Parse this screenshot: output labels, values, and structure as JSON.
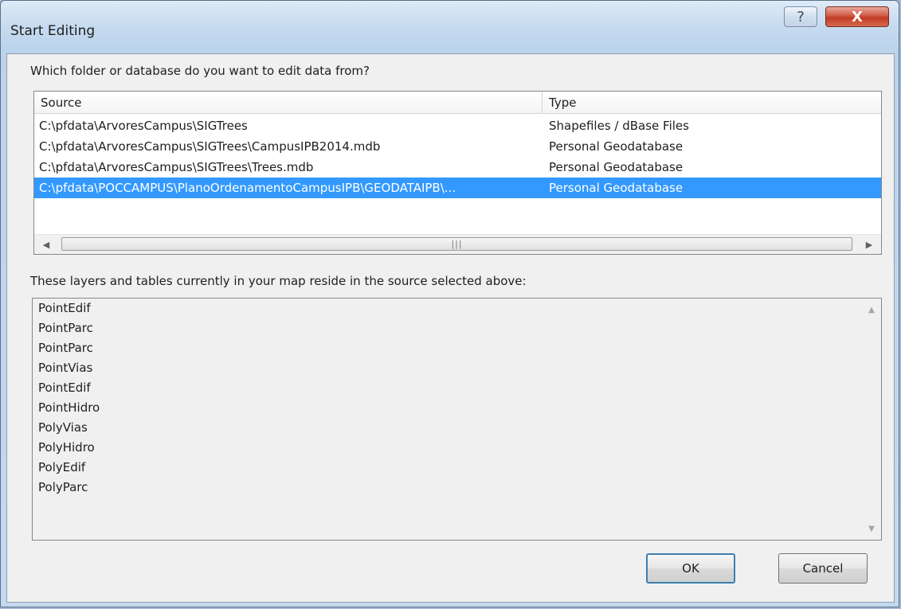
{
  "window": {
    "title": "Start Editing",
    "help_glyph": "?",
    "close_glyph": "X"
  },
  "question": "Which folder or database do you want to edit data from?",
  "source_table": {
    "columns": [
      "Source",
      "Type"
    ],
    "rows": [
      {
        "source": "C:\\pfdata\\ArvoresCampus\\SIGTrees",
        "type": "Shapefiles / dBase Files"
      },
      {
        "source": "C:\\pfdata\\ArvoresCampus\\SIGTrees\\CampusIPB2014.mdb",
        "type": "Personal Geodatabase"
      },
      {
        "source": "C:\\pfdata\\ArvoresCampus\\SIGTrees\\Trees.mdb",
        "type": "Personal Geodatabase"
      },
      {
        "source": "C:\\pfdata\\POCCAMPUS\\PlanoOrdenamentoCampusIPB\\GEODATAIPB\\...",
        "type": "Personal Geodatabase"
      }
    ],
    "selected_index": 3
  },
  "layers_label": "These layers and tables currently in your map reside in the source selected above:",
  "layers": [
    "PointEdif",
    "PointParc",
    "PointParc",
    "PointVias",
    "PointEdif",
    "PointHidro",
    "PolyVias",
    "PolyHidro",
    "PolyEdif",
    "PolyParc"
  ],
  "buttons": {
    "ok": "OK",
    "cancel": "Cancel"
  },
  "icons": {
    "scroll_left": "left-arrow-icon",
    "scroll_right": "right-arrow-icon",
    "scroll_up": "up-arrow-icon",
    "scroll_down": "down-arrow-icon"
  },
  "colors": {
    "selection": "#3399ff",
    "close_button": "#c23b22"
  }
}
